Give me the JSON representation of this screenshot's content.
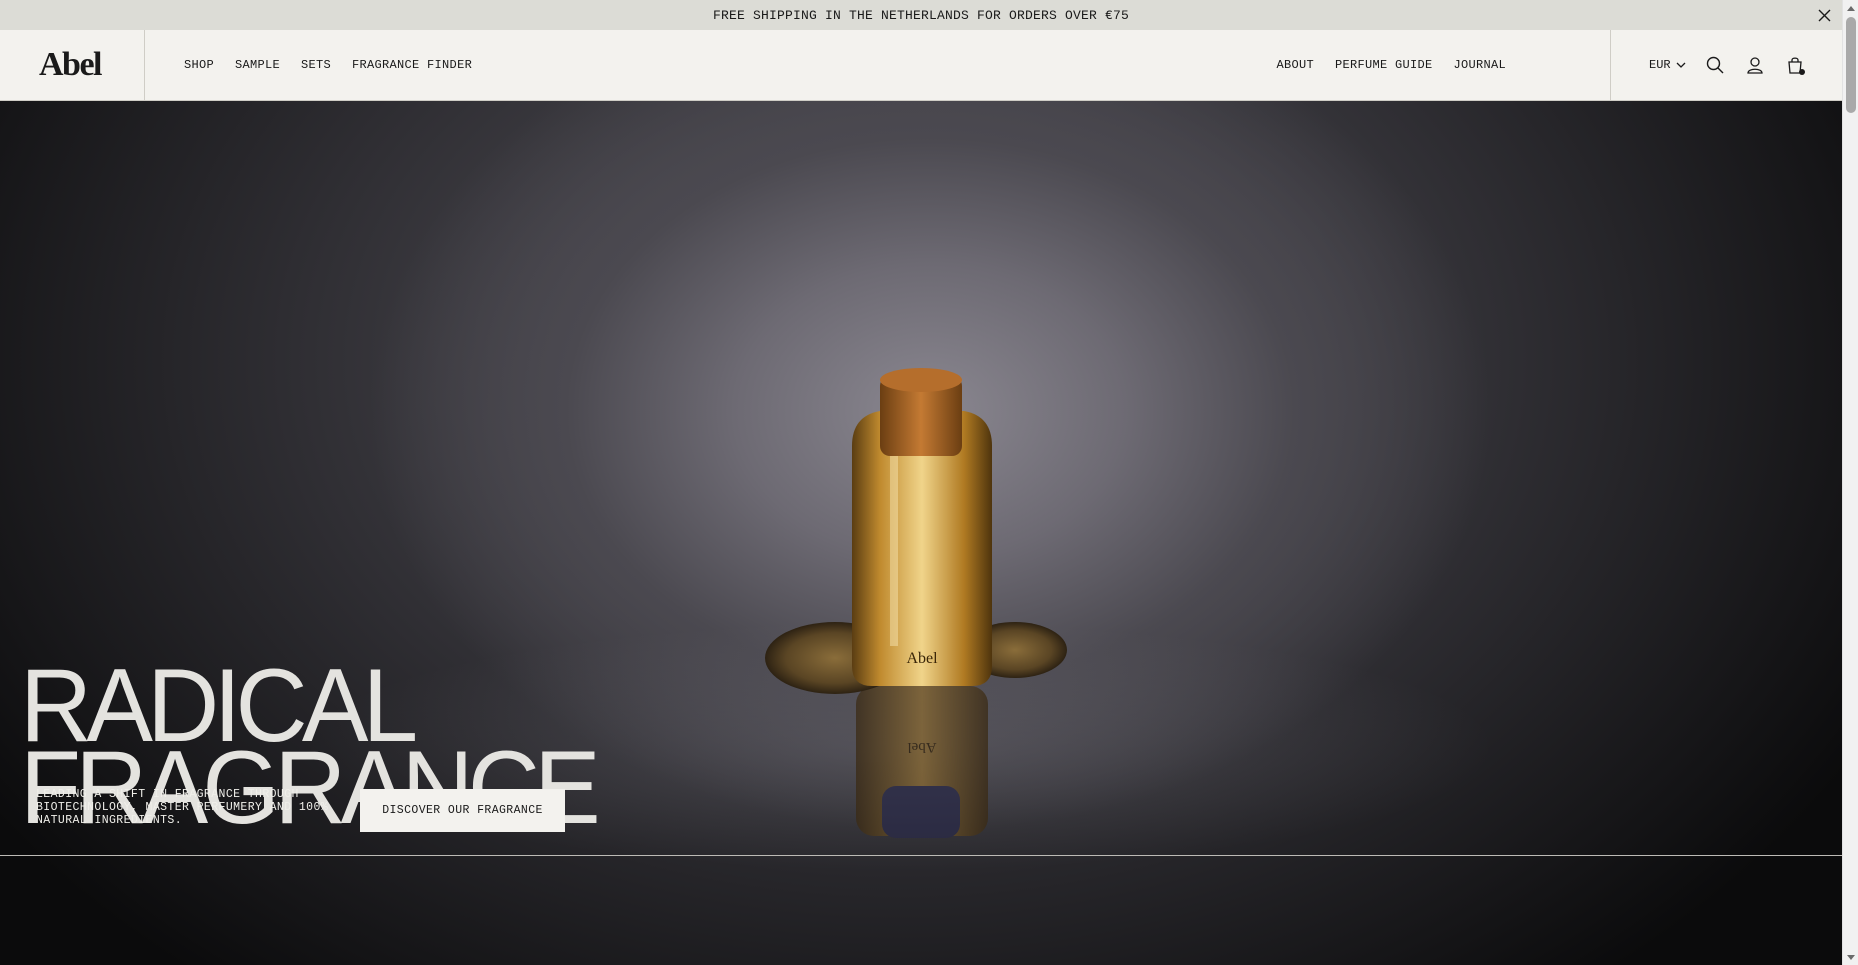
{
  "announcement": {
    "text": "FREE SHIPPING IN THE NETHERLANDS FOR ORDERS OVER €75",
    "close_icon": "close-icon"
  },
  "header": {
    "logo": "Abel",
    "nav_left": [
      "SHOP",
      "SAMPLE",
      "SETS",
      "FRAGRANCE FINDER"
    ],
    "nav_right": [
      "ABOUT",
      "PERFUME GUIDE",
      "JOURNAL"
    ],
    "currency": "EUR",
    "icons": [
      "chevron-down-icon",
      "search-icon",
      "account-icon",
      "cart-icon"
    ]
  },
  "hero": {
    "title_line1": "RADICAL",
    "title_line2": "FRAGRANCE",
    "tagline": "LEADING A SHIFT IN FRAGRANCE THROUGH BIOTECHNOLOGY, MASTER PERFUMERY AND 100% NATURAL INGREDIENTS.",
    "cta_label": "DISCOVER OUR FRAGRANCE",
    "bottle_label": "Abel",
    "bottle_reflection_label": "Abel"
  },
  "colors": {
    "header_bg": "#f3f2ee",
    "announce_bg": "#dcdcd6",
    "text_dark": "#1a1a1a",
    "hero_text": "#e4e3df",
    "amber": "#c78a2e"
  }
}
